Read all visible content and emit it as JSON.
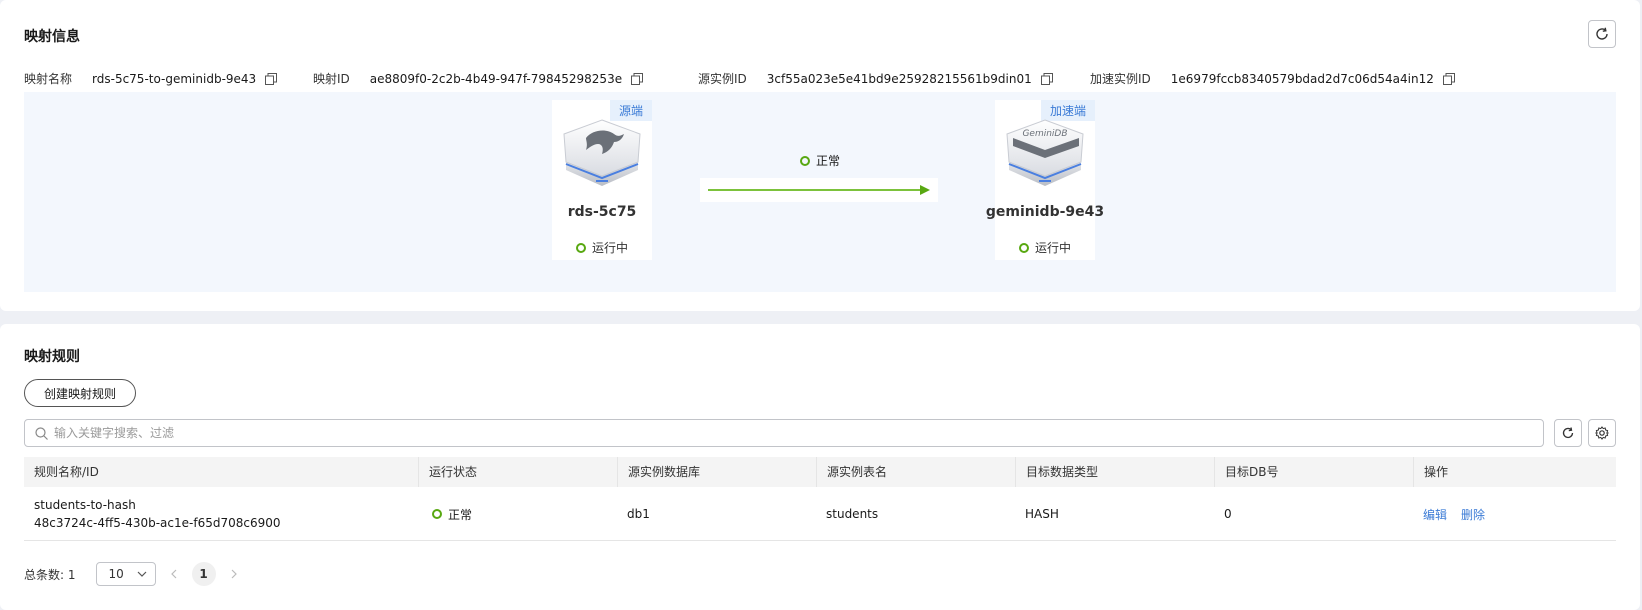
{
  "mapping_info": {
    "title": "映射信息",
    "fields": [
      {
        "label": "映射名称",
        "value": "rds-5c75-to-geminidb-9e43"
      },
      {
        "label": "映射ID",
        "value": "ae8809f0-2c2b-4b49-947f-79845298253e"
      },
      {
        "label": "源实例ID",
        "value": "3cf55a023e5e41bd9e25928215561b9din01"
      },
      {
        "label": "加速实例ID",
        "value": "1e6979fccb8340579bdad2d7c06d54a4in12"
      }
    ],
    "source_node": {
      "tag": "源端",
      "name": "rds-5c75",
      "status": "运行中"
    },
    "link_status": "正常",
    "target_node": {
      "tag": "加速端",
      "name": "geminidb-9e43",
      "status": "运行中",
      "logo_text": "GeminiDB"
    }
  },
  "mapping_rules": {
    "title": "映射规则",
    "create_button": "创建映射规则",
    "search": {
      "placeholder": "输入关键字搜索、过滤",
      "value": ""
    },
    "columns": [
      "规则名称/ID",
      "运行状态",
      "源实例数据库",
      "源实例表名",
      "目标数据类型",
      "目标DB号",
      "操作"
    ],
    "rows": [
      {
        "name": "students-to-hash",
        "id": "48c3724c-4ff5-430b-ac1e-f65d708c6900",
        "status": "正常",
        "database": "db1",
        "table": "students",
        "data_type": "HASH",
        "db_number": "0",
        "actions": [
          "编辑",
          "删除"
        ]
      }
    ],
    "pagination": {
      "total_label": "总条数: 1",
      "page_size": "10",
      "current_page": "1"
    }
  },
  "colors": {
    "accent": "#3b7bd6",
    "success": "#58a811",
    "panel_bg": "#f3f7fd"
  }
}
